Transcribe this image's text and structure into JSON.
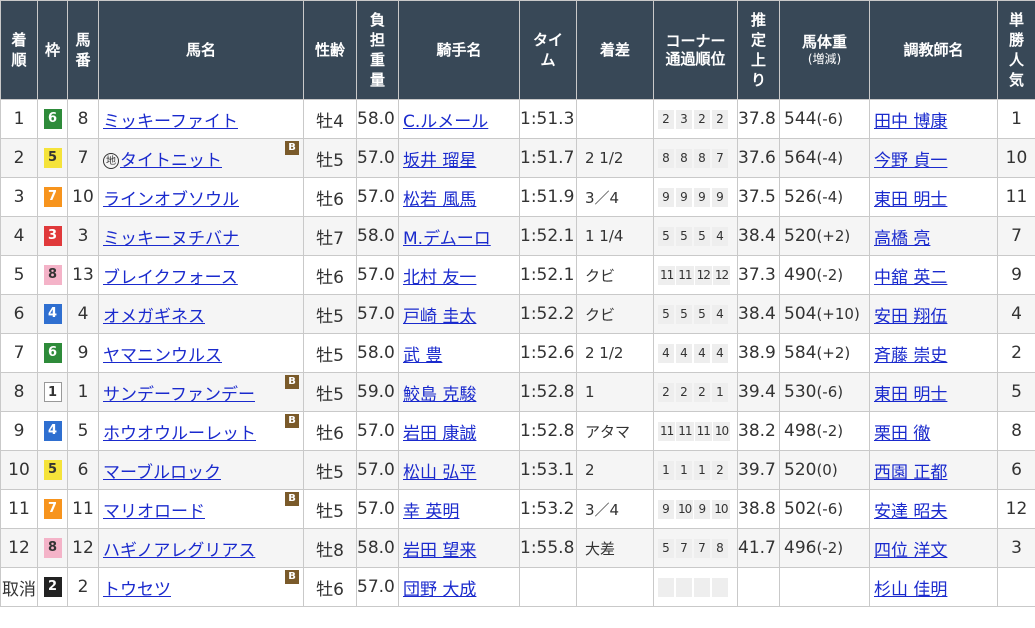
{
  "headers": {
    "rank": "着順",
    "waku": "枠",
    "umaban": "馬番",
    "horse": "馬名",
    "sexage": "性齢",
    "weight_carried": "負担重量",
    "jockey": "騎手名",
    "time": "タイム",
    "margin": "着差",
    "corner": "コーナー",
    "corner_sub": "通過順位",
    "last3f": "推定上り",
    "body_weight": "馬体重",
    "body_weight_sub": "(増減)",
    "trainer": "調教師名",
    "popularity": "単勝人気"
  },
  "rows": [
    {
      "rank": "1",
      "waku": "6",
      "umaban": "8",
      "horse": "ミッキーファイト",
      "local": "",
      "blinker": "",
      "sexage": "牡4",
      "wc": "58.0",
      "jockey": "C.ルメール",
      "time": "1:51.3",
      "margin": "",
      "corners": [
        "2",
        "3",
        "2",
        "2"
      ],
      "last3f": "37.8",
      "bw": "544",
      "bwchg": "(-6)",
      "trainer": "田中 博康",
      "pop": "1"
    },
    {
      "rank": "2",
      "waku": "5",
      "umaban": "7",
      "horse": "タイトニット",
      "local": "地",
      "blinker": "B",
      "sexage": "牡5",
      "wc": "57.0",
      "jockey": "坂井 瑠星",
      "time": "1:51.7",
      "margin": "2 1/2",
      "corners": [
        "8",
        "8",
        "8",
        "7"
      ],
      "last3f": "37.6",
      "bw": "564",
      "bwchg": "(-4)",
      "trainer": "今野 貞一",
      "pop": "10"
    },
    {
      "rank": "3",
      "waku": "7",
      "umaban": "10",
      "horse": "ラインオブソウル",
      "local": "",
      "blinker": "",
      "sexage": "牡6",
      "wc": "57.0",
      "jockey": "松若 風馬",
      "time": "1:51.9",
      "margin": "3／4",
      "corners": [
        "9",
        "9",
        "9",
        "9"
      ],
      "last3f": "37.5",
      "bw": "526",
      "bwchg": "(-4)",
      "trainer": "東田 明士",
      "pop": "11"
    },
    {
      "rank": "4",
      "waku": "3",
      "umaban": "3",
      "horse": "ミッキーヌチバナ",
      "local": "",
      "blinker": "",
      "sexage": "牡7",
      "wc": "58.0",
      "jockey": "M.デムーロ",
      "time": "1:52.1",
      "margin": "1 1/4",
      "corners": [
        "5",
        "5",
        "5",
        "4"
      ],
      "last3f": "38.4",
      "bw": "520",
      "bwchg": "(+2)",
      "trainer": "高橋 亮",
      "pop": "7"
    },
    {
      "rank": "5",
      "waku": "8",
      "umaban": "13",
      "horse": "ブレイクフォース",
      "local": "",
      "blinker": "",
      "sexage": "牡6",
      "wc": "57.0",
      "jockey": "北村 友一",
      "time": "1:52.1",
      "margin": "クビ",
      "corners": [
        "11",
        "11",
        "12",
        "12"
      ],
      "last3f": "37.3",
      "bw": "490",
      "bwchg": "(-2)",
      "trainer": "中舘 英二",
      "pop": "9"
    },
    {
      "rank": "6",
      "waku": "4",
      "umaban": "4",
      "horse": "オメガギネス",
      "local": "",
      "blinker": "",
      "sexage": "牡5",
      "wc": "57.0",
      "jockey": "戸崎 圭太",
      "time": "1:52.2",
      "margin": "クビ",
      "corners": [
        "5",
        "5",
        "5",
        "4"
      ],
      "last3f": "38.4",
      "bw": "504",
      "bwchg": "(+10)",
      "trainer": "安田 翔伍",
      "pop": "4"
    },
    {
      "rank": "7",
      "waku": "6",
      "umaban": "9",
      "horse": "ヤマニンウルス",
      "local": "",
      "blinker": "",
      "sexage": "牡5",
      "wc": "58.0",
      "jockey": "武 豊",
      "time": "1:52.6",
      "margin": "2 1/2",
      "corners": [
        "4",
        "4",
        "4",
        "4"
      ],
      "last3f": "38.9",
      "bw": "584",
      "bwchg": "(+2)",
      "trainer": "斉藤 崇史",
      "pop": "2"
    },
    {
      "rank": "8",
      "waku": "1",
      "umaban": "1",
      "horse": "サンデーファンデー",
      "local": "",
      "blinker": "B",
      "sexage": "牡5",
      "wc": "59.0",
      "jockey": "鮫島 克駿",
      "time": "1:52.8",
      "margin": "1",
      "corners": [
        "2",
        "2",
        "2",
        "1"
      ],
      "last3f": "39.4",
      "bw": "530",
      "bwchg": "(-6)",
      "trainer": "東田 明士",
      "pop": "5"
    },
    {
      "rank": "9",
      "waku": "4",
      "umaban": "5",
      "horse": "ホウオウルーレット",
      "local": "",
      "blinker": "B",
      "sexage": "牡6",
      "wc": "57.0",
      "jockey": "岩田 康誠",
      "time": "1:52.8",
      "margin": "アタマ",
      "corners": [
        "11",
        "11",
        "11",
        "10"
      ],
      "last3f": "38.2",
      "bw": "498",
      "bwchg": "(-2)",
      "trainer": "栗田 徹",
      "pop": "8"
    },
    {
      "rank": "10",
      "waku": "5",
      "umaban": "6",
      "horse": "マーブルロック",
      "local": "",
      "blinker": "",
      "sexage": "牡5",
      "wc": "57.0",
      "jockey": "松山 弘平",
      "time": "1:53.1",
      "margin": "2",
      "corners": [
        "1",
        "1",
        "1",
        "2"
      ],
      "last3f": "39.7",
      "bw": "520",
      "bwchg": "(0)",
      "trainer": "西園 正都",
      "pop": "6"
    },
    {
      "rank": "11",
      "waku": "7",
      "umaban": "11",
      "horse": "マリオロード",
      "local": "",
      "blinker": "B",
      "sexage": "牡5",
      "wc": "57.0",
      "jockey": "幸 英明",
      "time": "1:53.2",
      "margin": "3／4",
      "corners": [
        "9",
        "10",
        "9",
        "10"
      ],
      "last3f": "38.8",
      "bw": "502",
      "bwchg": "(-6)",
      "trainer": "安達 昭夫",
      "pop": "12"
    },
    {
      "rank": "12",
      "waku": "8",
      "umaban": "12",
      "horse": "ハギノアレグリアス",
      "local": "",
      "blinker": "",
      "sexage": "牡8",
      "wc": "58.0",
      "jockey": "岩田 望来",
      "time": "1:55.8",
      "margin": "大差",
      "corners": [
        "5",
        "7",
        "7",
        "8"
      ],
      "last3f": "41.7",
      "bw": "496",
      "bwchg": "(-2)",
      "trainer": "四位 洋文",
      "pop": "3"
    },
    {
      "rank": "取消",
      "waku": "2",
      "umaban": "2",
      "horse": "トウセツ",
      "local": "",
      "blinker": "B",
      "sexage": "牡6",
      "wc": "57.0",
      "jockey": "団野 大成",
      "time": "",
      "margin": "",
      "corners": [
        "",
        "",
        "",
        ""
      ],
      "last3f": "",
      "bw": "",
      "bwchg": "",
      "trainer": "杉山 佳明",
      "pop": ""
    }
  ]
}
